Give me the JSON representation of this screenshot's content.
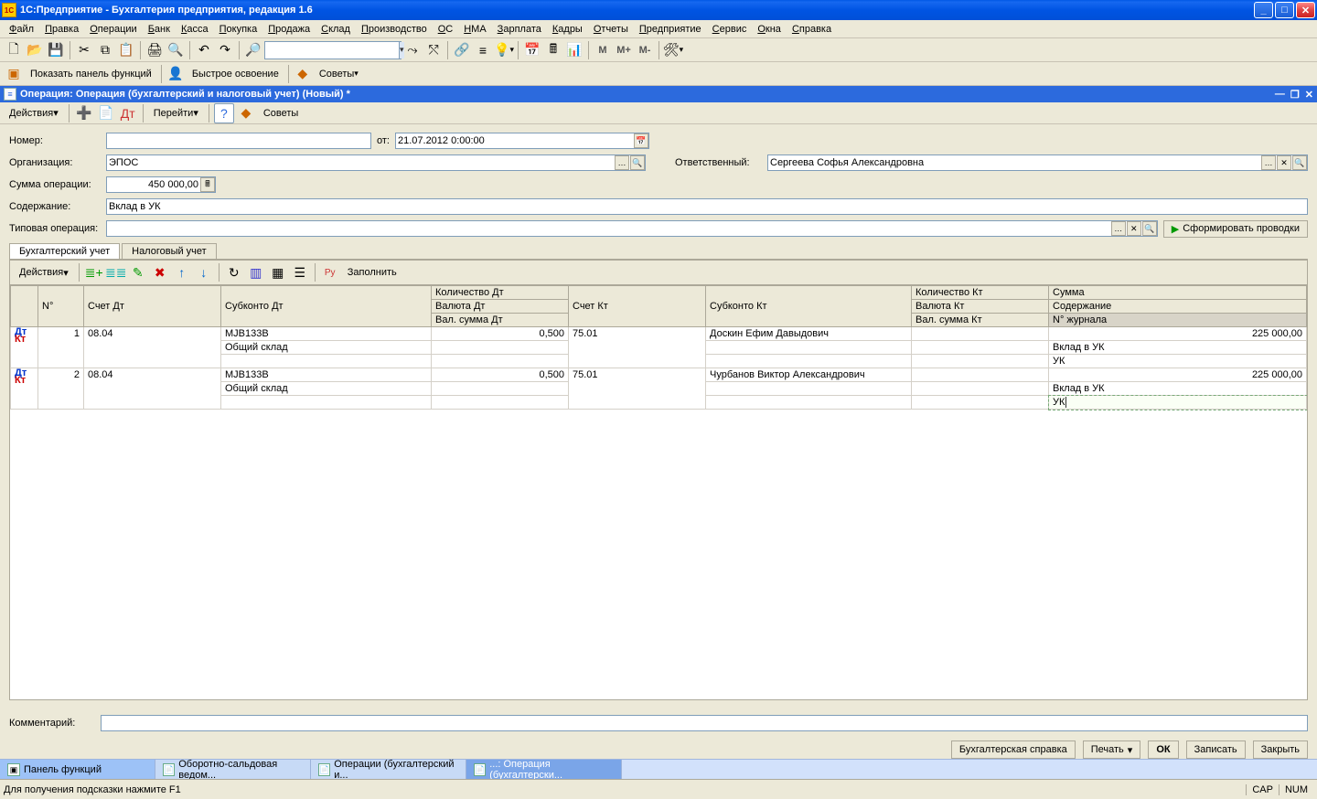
{
  "title": "1С:Предприятие - Бухгалтерия предприятия, редакция 1.6",
  "menu": [
    "Файл",
    "Правка",
    "Операции",
    "Банк",
    "Касса",
    "Покупка",
    "Продажа",
    "Склад",
    "Производство",
    "ОС",
    "НМА",
    "Зарплата",
    "Кадры",
    "Отчеты",
    "Предприятие",
    "Сервис",
    "Окна",
    "Справка"
  ],
  "toolbar_hint_panel": "Показать панель функций",
  "toolbar_quickstart": "Быстрое освоение",
  "toolbar_tips": "Советы",
  "docHeader": "Операция: Операция (бухгалтерский и налоговый учет) (Новый) *",
  "actionsLabel": "Действия",
  "gotoLabel": "Перейти",
  "form": {
    "numberLabel": "Номер:",
    "numberValue": "",
    "fromLabel": "от:",
    "dateValue": "21.07.2012  0:00:00",
    "orgLabel": "Организация:",
    "orgValue": "ЭПОС",
    "respLabel": "Ответственный:",
    "respValue": "Сергеева Софья Александровна",
    "sumLabel": "Сумма операции:",
    "sumValue": "450 000,00",
    "contentLabel": "Содержание:",
    "contentValue": "Вклад в УК",
    "typicalLabel": "Типовая операция:",
    "typicalValue": "",
    "generateBtn": "Сформировать проводки"
  },
  "tabs": {
    "accounting": "Бухгалтерский учет",
    "tax": "Налоговый учет"
  },
  "gridActions": "Действия",
  "fillLabel": "Заполнить",
  "headers": {
    "n": "N°",
    "acctD": "Счет Дт",
    "subD": "Субконто Дт",
    "qtyD": "Количество Дт",
    "curD": "Валюта Дт",
    "curSumD": "Вал. сумма Дт",
    "acctK": "Счет Кт",
    "subK": "Субконто Кт",
    "qtyK": "Количество Кт",
    "curK": "Валюта Кт",
    "curSumK": "Вал. сумма Кт",
    "sum": "Сумма",
    "desc": "Содержание",
    "journal": "N° журнала"
  },
  "rows": [
    {
      "n": "1",
      "acctD": "08.04",
      "subD1": "МJB133B",
      "subD2": "Общий склад",
      "qtyD": "0,500",
      "acctK": "75.01",
      "subK": "Доскин Ефим Давыдович",
      "sum": "225 000,00",
      "desc": "Вклад в УК",
      "journal": "УК"
    },
    {
      "n": "2",
      "acctD": "08.04",
      "subD1": "МJB133B",
      "subD2": "Общий склад",
      "qtyD": "0,500",
      "acctK": "75.01",
      "subK": "Чурбанов Виктор Александрович",
      "sum": "225 000,00",
      "desc": "Вклад в УК",
      "journal": "УК"
    }
  ],
  "commentLabel": "Комментарий:",
  "bottomButtons": {
    "spravka": "Бухгалтерская справка",
    "print": "Печать",
    "ok": "ОК",
    "save": "Записать",
    "close": "Закрыть"
  },
  "taskbar": [
    "Панель функций",
    "Оборотно-сальдовая ведом...",
    "Операции (бухгалтерский и...",
    "...: Операция (бухгалтерски..."
  ],
  "hint": "Для получения подсказки нажмите F1",
  "cap": "CAP",
  "num": "NUM",
  "tipsLabelInner": "Советы",
  "mPlus": "M+",
  "mMinus": "M-",
  "mLabel": "M"
}
